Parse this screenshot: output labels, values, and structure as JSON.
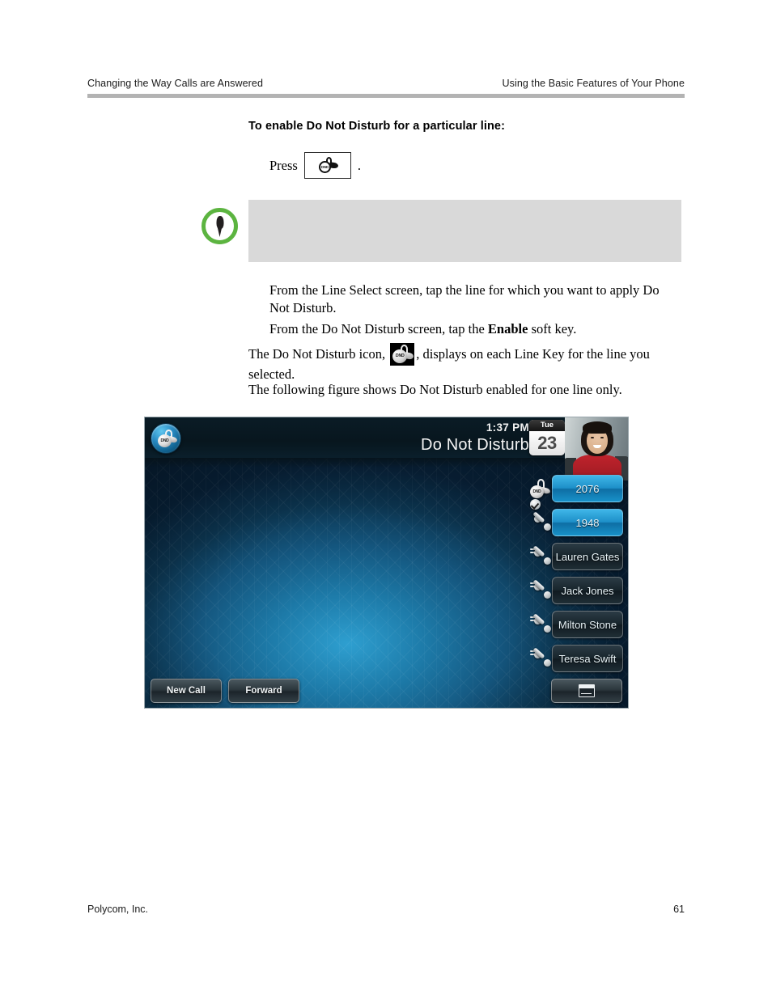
{
  "header": {
    "left": "Changing the Way Calls are Answered",
    "right": "Using the Basic Features of Your Phone"
  },
  "content": {
    "heading": "To enable Do Not Disturb for a particular line:",
    "press_label": "Press",
    "press_period": ".",
    "press_key_icon": "dnd-key-icon",
    "note_icon": "note-pin-icon",
    "note_text": "",
    "step1": "From the Line Select screen, tap the line for which you want to apply Do Not Disturb.",
    "step2_before": "From the Do Not Disturb screen, tap the ",
    "step2_bold": "Enable",
    "step2_after": " soft key.",
    "para3_before": "The Do Not Disturb icon, ",
    "para3_icon": "dnd-inline-icon",
    "para3_after": ", displays on each Line Key for the line you selected.",
    "para4": "The following figure shows Do Not Disturb enabled for one line only."
  },
  "phone": {
    "status_icon": "dnd-status-icon",
    "time": "1:37 PM",
    "title": "Do Not Disturb",
    "calendar": {
      "weekday": "Tue",
      "day": "23"
    },
    "photo_alt": "user-photo",
    "line_keys": [
      {
        "label": "2076",
        "icon": "dnd-line-icon",
        "state": "active"
      },
      {
        "label": "1948",
        "icon": "handset-check-icon",
        "state": "active"
      },
      {
        "label": "Lauren Gates",
        "icon": "handset-icon",
        "state": "idle"
      },
      {
        "label": "Jack Jones",
        "icon": "handset-icon",
        "state": "idle"
      },
      {
        "label": "Milton Stone",
        "icon": "handset-icon",
        "state": "idle"
      },
      {
        "label": "Teresa Swift",
        "icon": "handset-icon",
        "state": "idle"
      }
    ],
    "soft_keys": [
      {
        "label": "New Call"
      },
      {
        "label": "Forward"
      }
    ],
    "more_key_icon": "more-menu-icon",
    "colors": {
      "accent_blue": "#1d8fc8",
      "header_dark": "#08161e",
      "note_green": "#5cb440",
      "rule_gray": "#b3b3b3"
    }
  },
  "footer": {
    "company": "Polycom, Inc.",
    "page": "61"
  }
}
